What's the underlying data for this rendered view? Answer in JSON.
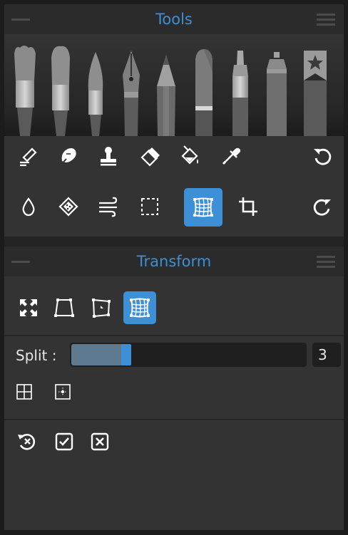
{
  "tools_panel": {
    "title": "Tools",
    "brushes": [
      "Paint Brush",
      "Flat Brush",
      "Round Brush",
      "Ink Pen",
      "Pencil",
      "Marker",
      "Felt Pen",
      "Airbrush",
      "Favourite Brushes"
    ],
    "tools_row1": [
      "Blend",
      "Smudge",
      "Clone Stamp",
      "Eraser",
      "Fill",
      "Color Picker",
      "Undo"
    ],
    "tools_row2": [
      "Water",
      "Texture",
      "Wind",
      "Selection",
      "Transform",
      "Crop",
      "Redo"
    ],
    "active_tool": "Transform"
  },
  "transform_panel": {
    "title": "Transform",
    "modes": [
      "Free Transform",
      "Perspective",
      "Distort",
      "Warp"
    ],
    "active_mode": "Warp",
    "split": {
      "label": "Split :",
      "value": "3",
      "fill_fraction": 0.23
    },
    "grid_options": [
      "Grid",
      "Center Grid"
    ],
    "actions": [
      "Reset",
      "Apply",
      "Cancel"
    ]
  },
  "colors": {
    "accent": "#3d8fd6",
    "panel": "#333333",
    "header": "#2b2b2b",
    "icon": "#ffffff"
  }
}
